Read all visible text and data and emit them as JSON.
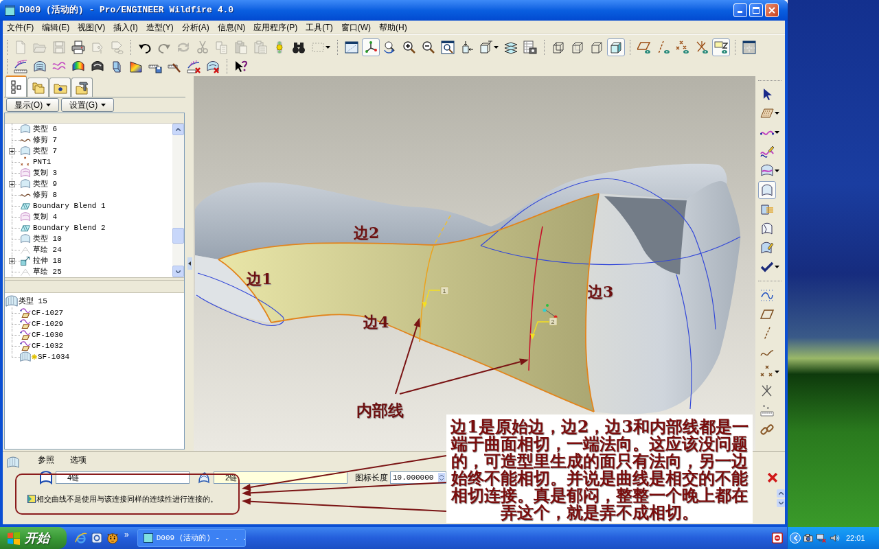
{
  "window": {
    "title": "D009 (活动的) - Pro/ENGINEER Wildfire 4.0"
  },
  "menu": [
    "文件(F)",
    "编辑(E)",
    "视图(V)",
    "插入(I)",
    "造型(Y)",
    "分析(A)",
    "信息(N)",
    "应用程序(P)",
    "工具(T)",
    "窗口(W)",
    "帮助(H)"
  ],
  "toolbar": {
    "rows": [
      [
        [
          {
            "kind": "new",
            "disabled": true,
            "pressed": false,
            "dropdown": false
          },
          {
            "kind": "open",
            "disabled": true,
            "pressed": false,
            "dropdown": false
          },
          {
            "kind": "save",
            "disabled": true,
            "pressed": false,
            "dropdown": false
          },
          {
            "kind": "print",
            "disabled": false,
            "pressed": false,
            "dropdown": false
          },
          {
            "kind": "tagclip",
            "disabled": true,
            "pressed": false,
            "dropdown": false
          },
          {
            "kind": "tagchain",
            "disabled": true,
            "pressed": false,
            "dropdown": false
          }
        ],
        [
          {
            "kind": "undo",
            "disabled": false,
            "pressed": false,
            "dropdown": false
          },
          {
            "kind": "redo",
            "disabled": true,
            "pressed": false,
            "dropdown": false
          },
          {
            "kind": "regen",
            "disabled": true,
            "pressed": false,
            "dropdown": false
          },
          {
            "kind": "cut",
            "disabled": true,
            "pressed": false,
            "dropdown": false
          },
          {
            "kind": "copy",
            "disabled": true,
            "pressed": false,
            "dropdown": false
          },
          {
            "kind": "paste",
            "disabled": true,
            "pressed": false,
            "dropdown": false
          },
          {
            "kind": "pastesp",
            "disabled": true,
            "pressed": false,
            "dropdown": false
          },
          {
            "kind": "signal",
            "disabled": false,
            "pressed": false,
            "dropdown": false
          },
          {
            "kind": "binoc",
            "disabled": false,
            "pressed": false,
            "dropdown": false
          },
          {
            "kind": "selbox",
            "disabled": true,
            "pressed": false,
            "dropdown": true
          }
        ],
        [
          {
            "kind": "window",
            "disabled": false,
            "pressed": false,
            "dropdown": false
          },
          {
            "kind": "node",
            "disabled": false,
            "pressed": true,
            "dropdown": false
          },
          {
            "kind": "orient",
            "disabled": false,
            "pressed": false,
            "dropdown": false
          },
          {
            "kind": "zin",
            "disabled": false,
            "pressed": false,
            "dropdown": false
          },
          {
            "kind": "zout",
            "disabled": false,
            "pressed": false,
            "dropdown": false
          },
          {
            "kind": "refit",
            "disabled": false,
            "pressed": false,
            "dropdown": false
          },
          {
            "kind": "reorient",
            "disabled": false,
            "pressed": false,
            "dropdown": false
          },
          {
            "kind": "views",
            "disabled": false,
            "pressed": false,
            "dropdown": true
          },
          {
            "kind": "layers",
            "disabled": false,
            "pressed": false,
            "dropdown": false
          },
          {
            "kind": "camera",
            "disabled": false,
            "pressed": false,
            "dropdown": false
          }
        ],
        [
          {
            "kind": "wire",
            "disabled": false,
            "pressed": false,
            "dropdown": false
          },
          {
            "kind": "hidden",
            "disabled": false,
            "pressed": false,
            "dropdown": false
          },
          {
            "kind": "nohid",
            "disabled": false,
            "pressed": false,
            "dropdown": false
          },
          {
            "kind": "shaded",
            "disabled": false,
            "pressed": true,
            "dropdown": false
          }
        ],
        [
          {
            "kind": "dplane",
            "disabled": false,
            "pressed": false,
            "dropdown": false
          },
          {
            "kind": "daxis",
            "disabled": false,
            "pressed": false,
            "dropdown": false
          },
          {
            "kind": "dpoint",
            "disabled": false,
            "pressed": false,
            "dropdown": false
          },
          {
            "kind": "dcsys",
            "disabled": false,
            "pressed": false,
            "dropdown": false
          },
          {
            "kind": "dnote",
            "disabled": false,
            "pressed": true,
            "dropdown": false
          }
        ],
        [
          {
            "kind": "grid",
            "disabled": false,
            "pressed": false,
            "dropdown": false
          }
        ]
      ],
      [
        [
          {
            "kind": "comb",
            "disabled": false,
            "pressed": false,
            "dropdown": false
          },
          {
            "kind": "domelines",
            "disabled": false,
            "pressed": false,
            "dropdown": false
          },
          {
            "kind": "wave",
            "disabled": false,
            "pressed": false,
            "dropdown": false
          },
          {
            "kind": "rainbow",
            "disabled": false,
            "pressed": false,
            "dropdown": false
          },
          {
            "kind": "dark",
            "disabled": false,
            "pressed": false,
            "dropdown": false
          },
          {
            "kind": "prism",
            "disabled": false,
            "pressed": false,
            "dropdown": false
          },
          {
            "kind": "sheet",
            "disabled": false,
            "pressed": false,
            "dropdown": false
          },
          {
            "kind": "rulerdisk",
            "disabled": false,
            "pressed": false,
            "dropdown": false
          },
          {
            "kind": "rulerbrush",
            "disabled": false,
            "pressed": false,
            "dropdown": false
          },
          {
            "kind": "combdel",
            "disabled": false,
            "pressed": false,
            "dropdown": false
          },
          {
            "kind": "domedel",
            "disabled": false,
            "pressed": false,
            "dropdown": false
          }
        ],
        [
          {
            "kind": "help",
            "disabled": false,
            "pressed": false,
            "dropdown": false
          }
        ]
      ]
    ]
  },
  "model_tree": {
    "tabs": [
      {
        "kind": "tree",
        "selected": true
      },
      {
        "kind": "folders",
        "selected": false
      },
      {
        "kind": "favorites",
        "selected": false
      },
      {
        "kind": "tools",
        "selected": false
      }
    ],
    "buttons": [
      "显示(O)",
      "设置(G)"
    ],
    "items": [
      {
        "kind": "style",
        "label": "类型 6",
        "collapsed": false
      },
      {
        "kind": "trim",
        "label": "修剪 7",
        "collapsed": false
      },
      {
        "kind": "style",
        "label": "类型 7",
        "collapsed": true
      },
      {
        "kind": "point",
        "label": "PNT1",
        "collapsed": false
      },
      {
        "kind": "copy",
        "label": "复制 3",
        "collapsed": false
      },
      {
        "kind": "style",
        "label": "类型 9",
        "collapsed": true
      },
      {
        "kind": "trim",
        "label": "修剪 8",
        "collapsed": false
      },
      {
        "kind": "blend",
        "label": "Boundary Blend 1",
        "collapsed": false
      },
      {
        "kind": "copy",
        "label": "复制 4",
        "collapsed": false
      },
      {
        "kind": "blend",
        "label": "Boundary Blend 2",
        "collapsed": false
      },
      {
        "kind": "style",
        "label": "类型 10",
        "collapsed": false
      },
      {
        "kind": "sketch",
        "label": "草绘 24",
        "collapsed": false
      },
      {
        "kind": "extrude",
        "label": "拉伸 18",
        "collapsed": true
      },
      {
        "kind": "sketch",
        "label": "草绘 25",
        "collapsed": false
      }
    ],
    "selection": {
      "kind": "surface",
      "label": "类型 15",
      "children": [
        {
          "kind": "cfeature",
          "label": "CF-1027",
          "marked": false
        },
        {
          "kind": "cfeature",
          "label": "CF-1029",
          "marked": false
        },
        {
          "kind": "cfeature",
          "label": "CF-1030",
          "marked": false
        },
        {
          "kind": "cfeature",
          "label": "CF-1032",
          "marked": false
        },
        {
          "kind": "surface",
          "label": "SF-1034",
          "marked": true
        }
      ]
    }
  },
  "graphics_area": {
    "edge_labels": [
      "边1",
      "边2",
      "边3",
      "边4"
    ],
    "internal_line_label": "内部线",
    "markers": [
      "1",
      "2"
    ]
  },
  "side_toolbar": {
    "groups": [
      [
        {
          "kind": "pick",
          "disabled": false,
          "pressed": false,
          "dropdown": false
        },
        {
          "kind": "dotplane",
          "disabled": false,
          "pressed": false,
          "dropdown": true
        },
        {
          "kind": "curve",
          "disabled": false,
          "pressed": false,
          "dropdown": true
        },
        {
          "kind": "curvepen",
          "disabled": false,
          "pressed": false,
          "dropdown": false
        },
        {
          "kind": "surfcurve",
          "disabled": false,
          "pressed": false,
          "dropdown": true
        },
        {
          "kind": "surf",
          "disabled": false,
          "pressed": true,
          "dropdown": false
        },
        {
          "kind": "surfmerge",
          "disabled": false,
          "pressed": false,
          "dropdown": false
        },
        {
          "kind": "surftrim",
          "disabled": false,
          "pressed": false,
          "dropdown": false
        },
        {
          "kind": "surfedit",
          "disabled": false,
          "pressed": false,
          "dropdown": false
        },
        {
          "kind": "check",
          "disabled": false,
          "pressed": false,
          "dropdown": true
        }
      ],
      [
        {
          "kind": "dotwave",
          "disabled": false,
          "pressed": false,
          "dropdown": false
        },
        {
          "kind": "plane",
          "disabled": false,
          "pressed": false,
          "dropdown": false
        },
        {
          "kind": "axis",
          "disabled": false,
          "pressed": false,
          "dropdown": false
        },
        {
          "kind": "bcurve",
          "disabled": false,
          "pressed": false,
          "dropdown": false
        },
        {
          "kind": "points",
          "disabled": false,
          "pressed": false,
          "dropdown": true
        },
        {
          "kind": "csys",
          "disabled": false,
          "pressed": false,
          "dropdown": false
        },
        {
          "kind": "rulerpts",
          "disabled": false,
          "pressed": false,
          "dropdown": false
        },
        {
          "kind": "chain",
          "disabled": false,
          "pressed": false,
          "dropdown": false
        }
      ]
    ]
  },
  "dashboard": {
    "tabs": [
      {
        "label": "参照",
        "selected": false
      },
      {
        "label": "选项",
        "selected": false
      }
    ],
    "chains": [
      {
        "kind": "surface",
        "value": "4链",
        "highlighted": false
      },
      {
        "kind": "curve",
        "value": "2链",
        "highlighted": true
      }
    ],
    "icon_length": {
      "label": "图标长度",
      "value": "10.000000"
    },
    "message": "相交曲线不是使用与该连接同样的连续性进行连接的。"
  },
  "callout": {
    "lines": [
      "边1是原始边，边2，边3和内部线都是一",
      "端于曲面相切，一端法向。这应该没问题",
      "的，可造型里生成的面只有法向，另一边",
      "始终不能相切。并说是曲线是相交的不能",
      "相切连接。真是郁闷，整整一个晚上都在",
      "弄这个，就是弄不成相切。"
    ]
  },
  "taskbar": {
    "start": "开始",
    "overflow": "»",
    "tasks": [
      {
        "label": "D009 (活动的) - . . .",
        "selected": false
      }
    ],
    "clock": "22:01"
  }
}
